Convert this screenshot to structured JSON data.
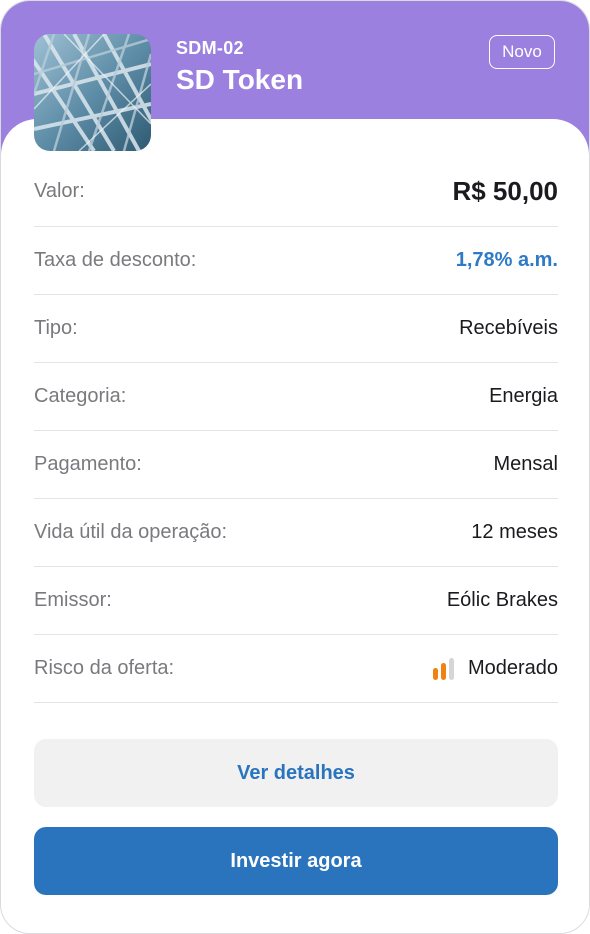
{
  "token": {
    "code": "SDM-02",
    "name": "SD Token",
    "badge": "Novo"
  },
  "details": [
    {
      "label": "Valor:",
      "value": "R$ 50,00"
    },
    {
      "label": "Taxa de desconto:",
      "value": "1,78% a.m."
    },
    {
      "label": "Tipo:",
      "value": "Recebíveis"
    },
    {
      "label": "Categoria:",
      "value": "Energia"
    },
    {
      "label": "Pagamento:",
      "value": "Mensal"
    },
    {
      "label": "Vida útil da operação:",
      "value": "12 meses"
    },
    {
      "label": "Emissor:",
      "value": "Eólic Brakes"
    },
    {
      "label": "Risco da oferta:",
      "value": "Moderado"
    }
  ],
  "risk_indicator": {
    "level": 2,
    "max": 3,
    "active_color": "#f0830f",
    "inactive_color": "#d6d6d6",
    "icon": "signal-bars-icon"
  },
  "actions": {
    "details_label": "Ver detalhes",
    "invest_label": "Investir agora"
  },
  "colors": {
    "header": "#9b80e0",
    "accent": "#2f7ac6",
    "primary_button": "#2a74bd"
  }
}
